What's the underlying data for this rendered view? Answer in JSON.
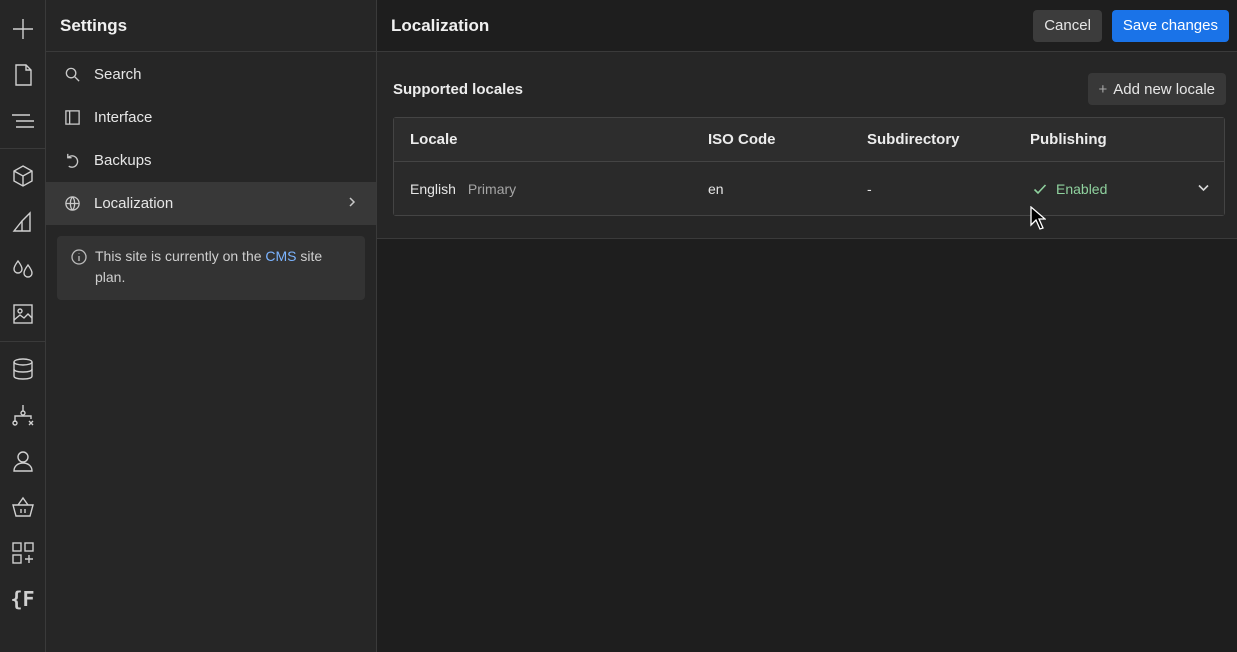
{
  "rail": {
    "icons": [
      "plus-icon",
      "page-icon",
      "navigator-icon",
      "cube-icon",
      "style-icon",
      "drops-icon",
      "image-icon",
      "database-icon",
      "logic-icon",
      "user-icon",
      "basket-icon",
      "apps-icon",
      "code-icon"
    ],
    "bottom_glyph": "{F"
  },
  "sidebar": {
    "title": "Settings",
    "items": [
      {
        "label": "Search",
        "icon": "search-icon"
      },
      {
        "label": "Interface",
        "icon": "interface-icon"
      },
      {
        "label": "Backups",
        "icon": "backups-icon"
      },
      {
        "label": "Localization",
        "icon": "globe-icon",
        "active": true
      }
    ],
    "plan_note": {
      "prefix": "This site is currently on the ",
      "link": "CMS",
      "suffix": " site plan."
    }
  },
  "main": {
    "title": "Localization",
    "cancel_label": "Cancel",
    "save_label": "Save changes",
    "section_title": "Supported locales",
    "add_label": "Add new locale",
    "add_symbol": "+",
    "table": {
      "columns": [
        "Locale",
        "ISO Code",
        "Subdirectory",
        "Publishing"
      ],
      "rows": [
        {
          "locale": "English",
          "tag": "Primary",
          "iso": "en",
          "subdirectory": "-",
          "publishing": "Enabled"
        }
      ]
    }
  },
  "colors": {
    "accent": "#1a73e8",
    "enabled": "#8fd19e",
    "link": "#7cb4ff"
  }
}
